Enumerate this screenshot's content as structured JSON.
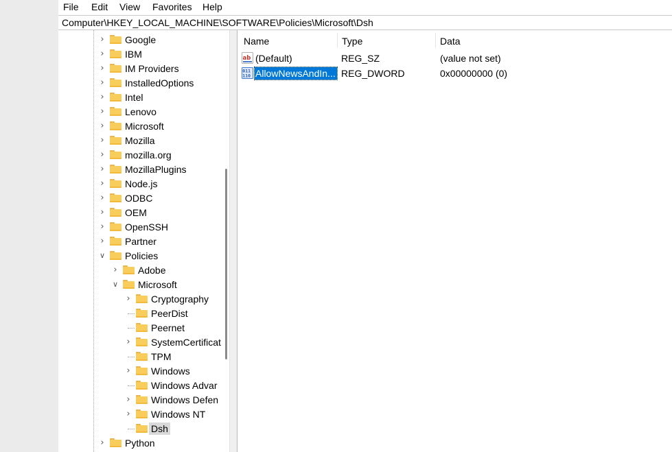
{
  "menu": {
    "file": "File",
    "edit": "Edit",
    "view": "View",
    "favorites": "Favorites",
    "help": "Help"
  },
  "address": "Computer\\HKEY_LOCAL_MACHINE\\SOFTWARE\\Policies\\Microsoft\\Dsh",
  "tree": {
    "google": "Google",
    "ibm": "IBM",
    "im_providers": "IM Providers",
    "installed_options": "InstalledOptions",
    "intel": "Intel",
    "lenovo": "Lenovo",
    "microsoft": "Microsoft",
    "mozilla": "Mozilla",
    "mozilla_org": "mozilla.org",
    "mozilla_plugins": "MozillaPlugins",
    "nodejs": "Node.js",
    "odbc": "ODBC",
    "oem": "OEM",
    "openssh": "OpenSSH",
    "partner": "Partner",
    "policies": "Policies",
    "adobe": "Adobe",
    "policies_microsoft": "Microsoft",
    "cryptography": "Cryptography",
    "peerdist": "PeerDist",
    "peernet": "Peernet",
    "system_certificates": "SystemCertificat",
    "tpm": "TPM",
    "windows": "Windows",
    "windows_advanced": "Windows Advar",
    "windows_defender": "Windows Defen",
    "windows_nt": "Windows NT",
    "dsh": "Dsh",
    "python": "Python"
  },
  "list": {
    "headers": {
      "name": "Name",
      "type": "Type",
      "data": "Data"
    },
    "rows": [
      {
        "name": "(Default)",
        "type": "REG_SZ",
        "data": "(value not set)",
        "icon": "string-value-icon"
      },
      {
        "name": "AllowNewsAndIn...",
        "type": "REG_DWORD",
        "data": "0x00000000 (0)",
        "icon": "dword-value-icon"
      }
    ]
  },
  "colors": {
    "selection": "#0078d7",
    "folder": "#f9cd5b",
    "tree_selection": "#d9d9d9"
  }
}
